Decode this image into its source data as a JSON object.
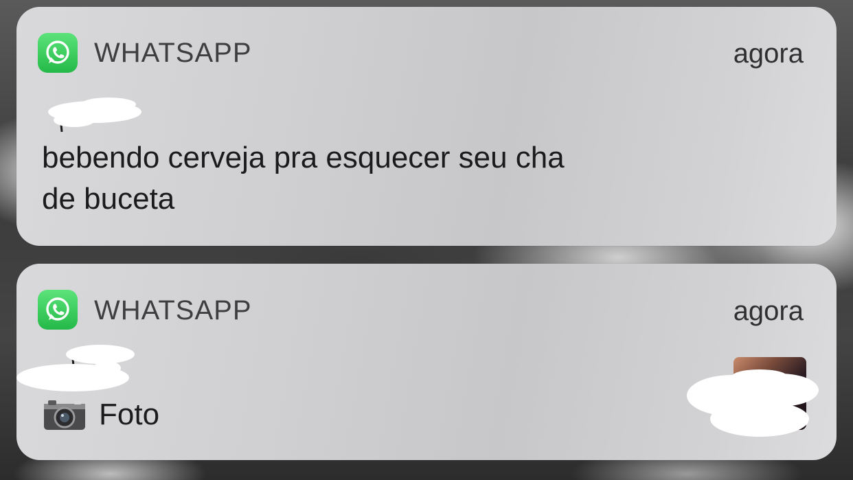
{
  "notifications": [
    {
      "app_name": "WHATSAPP",
      "time": "agora",
      "app_icon": "whatsapp-icon",
      "sender_redacted": true,
      "message_line1": "bebendo cerveja pra esquecer seu cha",
      "message_line2": "de buceta"
    },
    {
      "app_name": "WHATSAPP",
      "time": "agora",
      "app_icon": "whatsapp-icon",
      "sender_redacted": true,
      "attachment_icon": "camera-icon",
      "attachment_label": "Foto",
      "thumbnail_redacted": true
    }
  ],
  "colors": {
    "whatsapp_green": "#25D366",
    "card_background": "#D4D4D6",
    "text_primary": "#1B1B1D",
    "text_secondary": "#3E3E40"
  }
}
